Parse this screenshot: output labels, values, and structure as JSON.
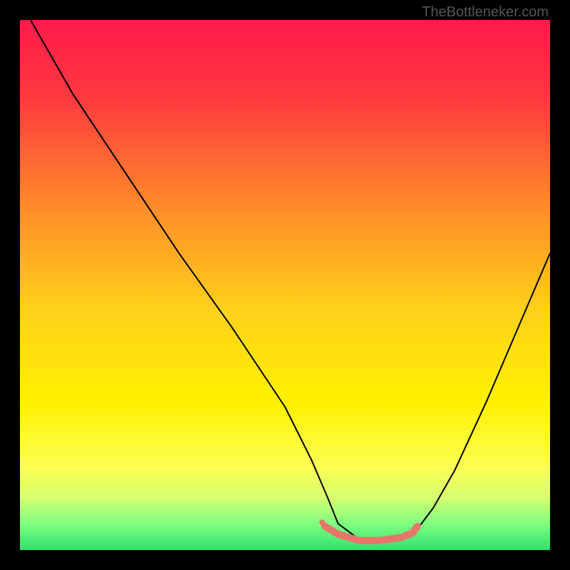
{
  "watermark": "TheBottleneker.com",
  "chart_data": {
    "type": "line",
    "title": "",
    "xlabel": "",
    "ylabel": "",
    "xlim": [
      0,
      100
    ],
    "ylim": [
      0,
      100
    ],
    "grid": false,
    "background_gradient": {
      "stops": [
        {
          "offset": 0.0,
          "color": "#ff1a4a"
        },
        {
          "offset": 0.15,
          "color": "#ff3a3f"
        },
        {
          "offset": 0.35,
          "color": "#ff8a2a"
        },
        {
          "offset": 0.55,
          "color": "#ffd21a"
        },
        {
          "offset": 0.72,
          "color": "#fff000"
        },
        {
          "offset": 0.84,
          "color": "#fdff50"
        },
        {
          "offset": 0.9,
          "color": "#d8ff70"
        },
        {
          "offset": 0.95,
          "color": "#80ff80"
        },
        {
          "offset": 1.0,
          "color": "#30e070"
        }
      ]
    },
    "series": [
      {
        "name": "bottleneck-curve",
        "color": "#000000",
        "width": 2,
        "x": [
          2,
          10,
          20,
          30,
          40,
          50,
          55,
          58,
          60,
          64,
          70,
          75,
          78,
          82,
          88,
          94,
          100
        ],
        "values": [
          100,
          86,
          71,
          56,
          42,
          27,
          17,
          10,
          5,
          2,
          2,
          4,
          8,
          15,
          28,
          42,
          56
        ]
      },
      {
        "name": "optimal-range-highlight",
        "color": "#e8756a",
        "width": 10,
        "x": [
          57.5,
          60,
          64,
          68,
          72,
          74,
          75
        ],
        "values": [
          4.5,
          3,
          1.8,
          1.8,
          2.4,
          3.2,
          4.5
        ]
      }
    ],
    "markers": [
      {
        "name": "optimal-start-dot",
        "x": 57,
        "y": 5.2,
        "color": "#e8756a",
        "size": 8
      }
    ]
  }
}
